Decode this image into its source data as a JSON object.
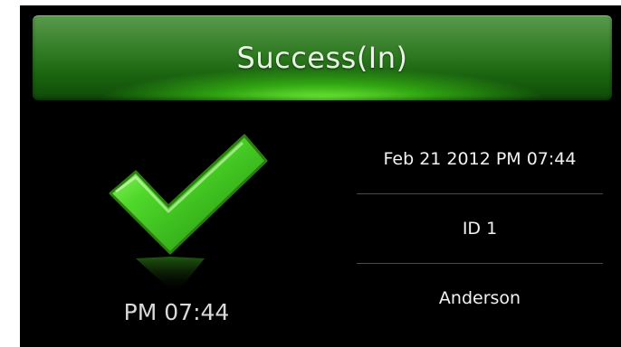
{
  "banner": {
    "title": "Success(In)"
  },
  "status": {
    "time": "PM 07:44"
  },
  "details": {
    "datetime": "Feb 21  2012 PM 07:44",
    "id": "ID 1",
    "name": "Anderson"
  },
  "colors": {
    "banner_green": "#2f7a22",
    "check_green": "#39c21a",
    "background": "#000000",
    "text": "#f2f2f2"
  },
  "icons": {
    "status_icon": "checkmark-icon"
  }
}
